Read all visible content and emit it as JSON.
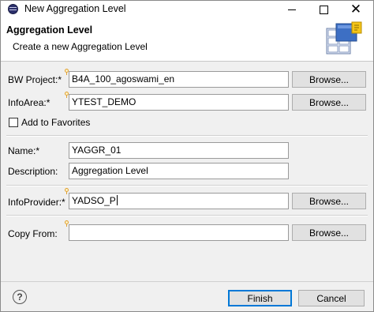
{
  "window": {
    "title": "New Aggregation Level"
  },
  "banner": {
    "title": "Aggregation Level",
    "subtitle": "Create a new Aggregation Level",
    "icon": "wizard-image-icon"
  },
  "form": {
    "bw_project": {
      "label": "BW Project:*",
      "value": "B4A_100_agoswami_en",
      "browse": "Browse..."
    },
    "info_area": {
      "label": "InfoArea:*",
      "value": "YTEST_DEMO",
      "browse": "Browse..."
    },
    "add_to_favorites": {
      "label": "Add to Favorites",
      "checked": false
    },
    "name": {
      "label": "Name:*",
      "value": "YAGGR_01"
    },
    "description": {
      "label": "Description:",
      "value": "Aggregation Level"
    },
    "info_provider": {
      "label": "InfoProvider:*",
      "value": "YADSO_P",
      "browse": "Browse..."
    },
    "copy_from": {
      "label": "Copy From:",
      "value": "",
      "browse": "Browse..."
    }
  },
  "footer": {
    "help": "?",
    "finish": "Finish",
    "cancel": "Cancel"
  },
  "colors": {
    "dialog_bg": "#f0f0f0",
    "button_bg": "#e1e1e1",
    "default_button_border": "#0078d7"
  }
}
